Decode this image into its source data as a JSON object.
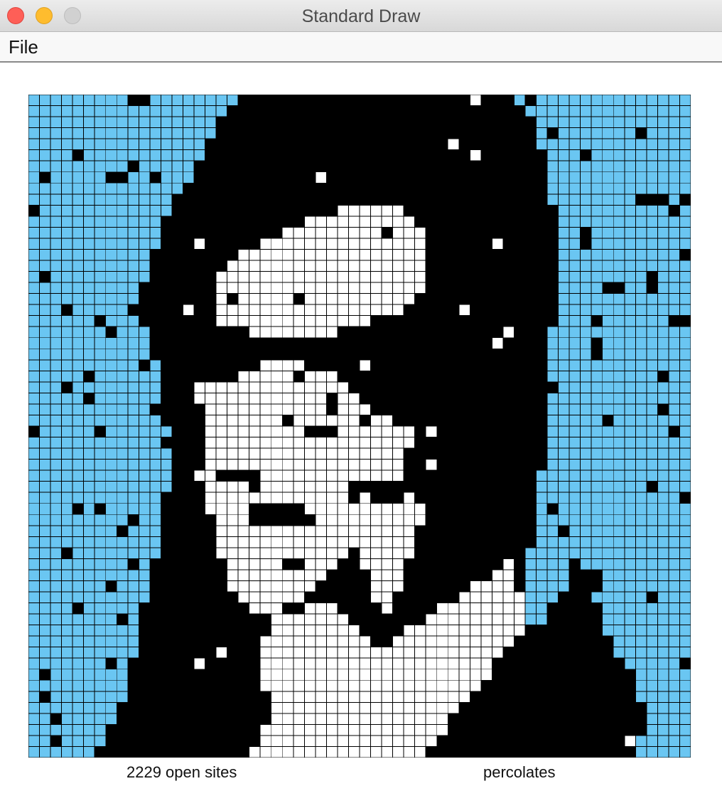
{
  "window": {
    "title": "Standard Draw",
    "controls": [
      "close",
      "minimize",
      "zoom"
    ]
  },
  "menu": {
    "items": [
      {
        "label": "File"
      }
    ]
  },
  "status": {
    "open_sites": "2229 open sites",
    "result": "percolates"
  },
  "colors": {
    "blocked": "#000000",
    "open": "#ffffff",
    "full": "#6ac6f2",
    "grid_line": "#000000"
  },
  "grid_size": 60
}
